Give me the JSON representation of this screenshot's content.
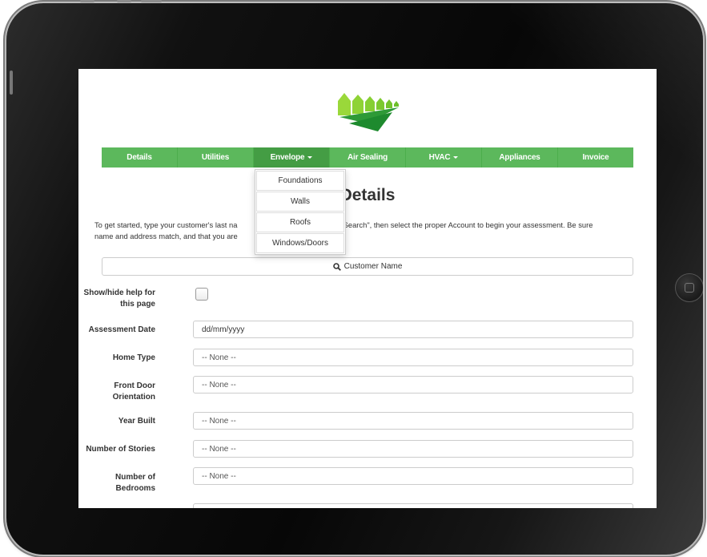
{
  "nav": {
    "items": [
      {
        "label": "Details"
      },
      {
        "label": "Utilities"
      },
      {
        "label": "Envelope"
      },
      {
        "label": "Air Sealing"
      },
      {
        "label": "HVAC"
      },
      {
        "label": "Appliances"
      },
      {
        "label": "Invoice"
      }
    ],
    "envelope_menu": [
      "Foundations",
      "Walls",
      "Roofs",
      "Windows/Doors"
    ]
  },
  "page": {
    "title": "Details",
    "intro_line1": "To get started, type your customer's last na",
    "intro_line1_rest": "tap \"Search\", then select the proper Account to begin your assessment. Be sure",
    "intro_line2": "name and address match, and that you are"
  },
  "search": {
    "label": "Customer Name",
    "icon": "search-icon"
  },
  "form": {
    "help_label": "Show/hide help for this page",
    "assessment_date": {
      "label": "Assessment Date",
      "value": "dd/mm/yyyy"
    },
    "home_type": {
      "label": "Home Type",
      "value": "-- None --"
    },
    "front_door": {
      "label": "Front Door Orientation",
      "value": "-- None --"
    },
    "year_built": {
      "label": "Year Built",
      "value": "-- None --"
    },
    "stories": {
      "label": "Number of Stories",
      "value": "-- None --"
    },
    "bedrooms": {
      "label": "Number of Bedrooms",
      "value": "-- None --"
    }
  },
  "colors": {
    "nav_green": "#5cb85c",
    "nav_active": "#449d44",
    "logo_light": "#9ad83a",
    "logo_dark": "#1e8a2e"
  }
}
